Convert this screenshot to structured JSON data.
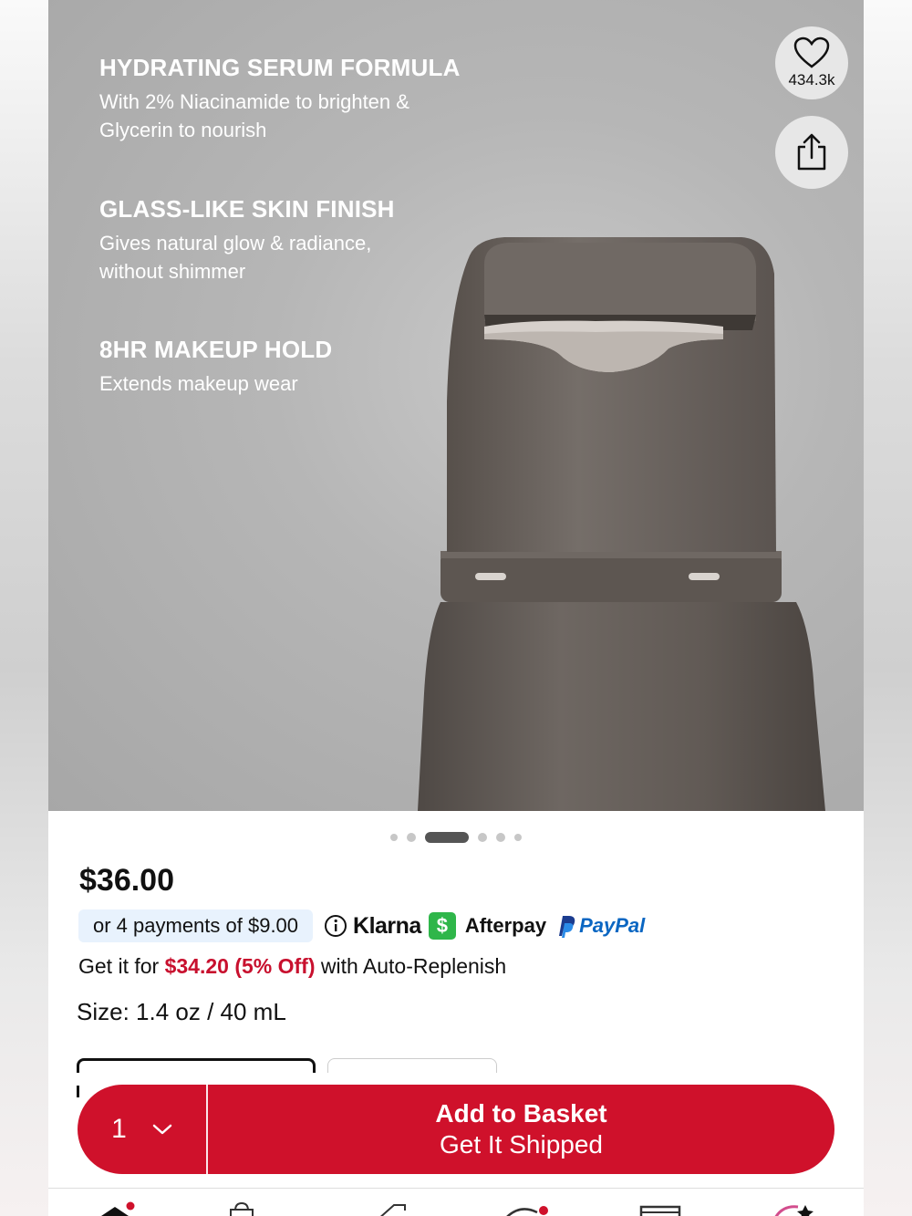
{
  "hero": {
    "claims": [
      {
        "title": "HYDRATING SERUM FORMULA",
        "text": "With 2% Niacinamide to brighten & Glycerin to nourish"
      },
      {
        "title": "GLASS-LIKE SKIN FINISH",
        "text": "Gives natural glow & radiance, without shimmer"
      },
      {
        "title": "8HR MAKEUP HOLD",
        "text": "Extends makeup wear"
      }
    ],
    "favorite": {
      "icon": "heart-icon",
      "count": "434.3k"
    },
    "share": {
      "icon": "share-icon"
    },
    "carousel": {
      "total": 6,
      "active_index": 2
    }
  },
  "product": {
    "price": "$36.00",
    "payments": {
      "installments": "or 4 payments of $9.00",
      "klarna": "Klarna",
      "afterpay_badge": "$",
      "afterpay": "Afterpay",
      "paypal": "PayPal"
    },
    "auto_replenish": {
      "prefix": "Get it for ",
      "price": "$34.20 (5% Off)",
      "suffix": " with Auto-Replenish"
    },
    "size": "Size: 1.4 oz / 40 mL"
  },
  "cta": {
    "quantity": "1",
    "add_label": "Add to Basket",
    "sub_label": "Get It Shipped"
  },
  "colors": {
    "brand_red": "#cf112b",
    "paypal_blue": "#0a66c2",
    "afterpay_green": "#2fb64a",
    "installment_bg": "#e8f2fd"
  },
  "tabbar": {
    "icons": [
      "home-icon",
      "shop-icon",
      "offers-icon",
      "community-icon",
      "store-icon",
      "me-icon"
    ]
  }
}
